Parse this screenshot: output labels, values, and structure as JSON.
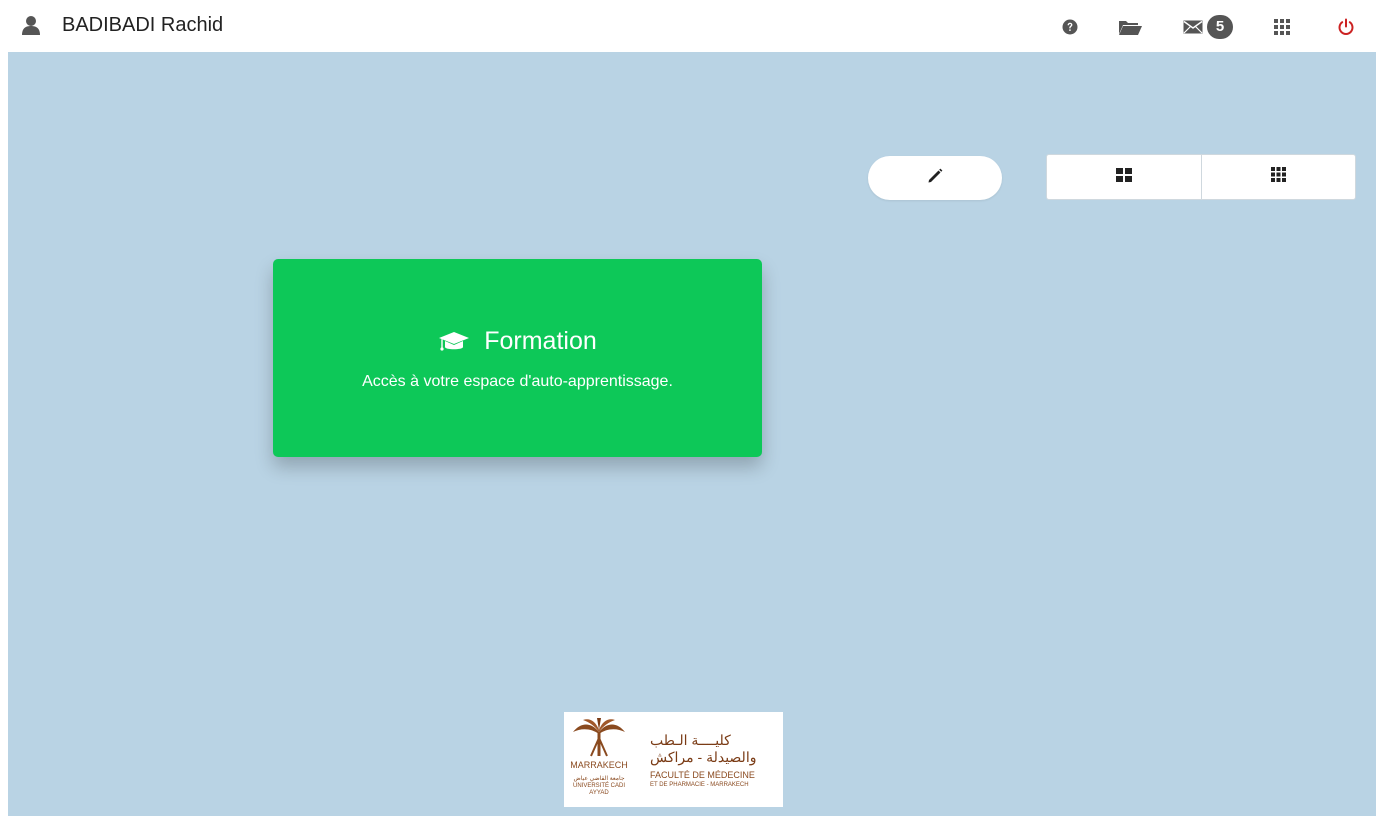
{
  "header": {
    "user_name": "BADIBADI Rachid",
    "mail_count": "5"
  },
  "toolbar": {
    "edit_icon": "pencil-icon",
    "view_large_icon": "large-grid-icon",
    "view_small_icon": "small-grid-icon"
  },
  "tile": {
    "title": "Formation",
    "description": "Accès à votre espace d'auto-apprentissage.",
    "icon": "graduation-cap-icon",
    "color": "#0dc858"
  },
  "logo": {
    "arabic_line1": "كليــــة الـطب",
    "arabic_line2": "والصيدلة - مراكش",
    "emblem_city": "MARRAKECH",
    "emblem_arabic": "جامعة القاضي عياض",
    "emblem_university": "UNIVERSITÉ CADI AYYAD",
    "french_line1": "FACULTÉ DE MÉDECINE",
    "french_line2": "ET DE PHARMACIE - MARRAKECH"
  },
  "colors": {
    "background": "#b9d3e4",
    "power": "#cc2222",
    "tile": "#0dc858"
  }
}
